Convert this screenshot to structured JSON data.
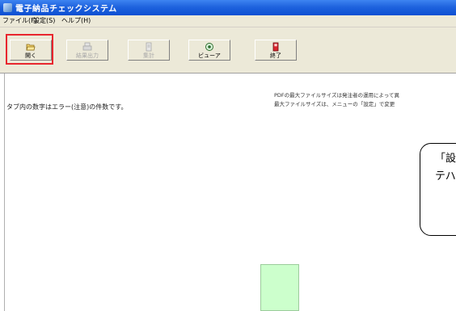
{
  "window": {
    "title": "電子納品チェックシステム"
  },
  "menu": [
    "ファイル(F)",
    "設定(S)",
    "ヘルプ(H)"
  ],
  "toolbar": {
    "buttons": [
      {
        "label": "開く",
        "icon": "folder-open-icon",
        "enabled": true
      },
      {
        "label": "結果出力",
        "icon": "print-output-icon",
        "enabled": false
      },
      {
        "label": "集計",
        "icon": "tally-icon",
        "enabled": false
      },
      {
        "label": "ビューア",
        "icon": "viewer-icon",
        "enabled": true
      },
      {
        "label": "終了",
        "icon": "exit-icon",
        "enabled": true
      }
    ]
  },
  "main": {
    "tab_note": "タブ内の数字はエラー(注意)の件数です。",
    "pdf_note_line1": "PDFの最大ファイルサイズは発注者の運用によって異",
    "pdf_note_line2": "最大ファイルサイズは、メニューの「設定」で変更"
  },
  "callout": {
    "line1": "「設",
    "line2": "テハ"
  },
  "colors": {
    "titlebar": "#1f63de",
    "highlight": "#e8262e",
    "green_box": "#ccffcc"
  }
}
